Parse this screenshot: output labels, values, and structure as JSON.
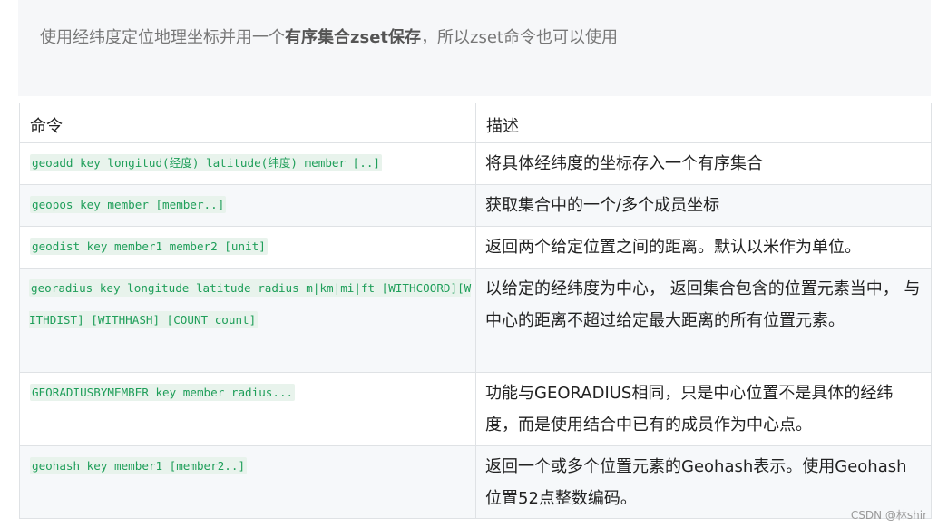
{
  "note": {
    "prefix": "使用经纬度定位地理坐标并用一个",
    "bold": "有序集合zset保存",
    "suffix": "，所以zset命令也可以使用"
  },
  "table": {
    "headers": [
      "命令",
      "描述"
    ],
    "rows": [
      {
        "cmd": "geoadd key longitud(经度) latitude(纬度) member [..]",
        "desc": "将具体经纬度的坐标存入一个有序集合"
      },
      {
        "cmd": "geopos key member [member..]",
        "desc": "获取集合中的一个/多个成员坐标"
      },
      {
        "cmd": "geodist key member1 member2 [unit]",
        "desc": "返回两个给定位置之间的距离。默认以米作为单位。"
      },
      {
        "cmd": "georadius key longitude latitude radius m|km|mi|ft [WITHCOORD][WITHDIST] [WITHHASH] [COUNT count]",
        "desc": "以给定的经纬度为中心， 返回集合包含的位置元素当中， 与中心的距离不超过给定最大距离的所有位置元素。"
      },
      {
        "cmd": "GEORADIUSBYMEMBER key member radius...",
        "desc": "功能与GEORADIUS相同，只是中心位置不是具体的经纬度，而是使用结合中已有的成员作为中心点。"
      },
      {
        "cmd": "geohash key member1 [member2..]",
        "desc": "返回一个或多个位置元素的Geohash表示。使用Geohash位置52点整数编码。"
      }
    ]
  },
  "watermark": "CSDN @林shir"
}
